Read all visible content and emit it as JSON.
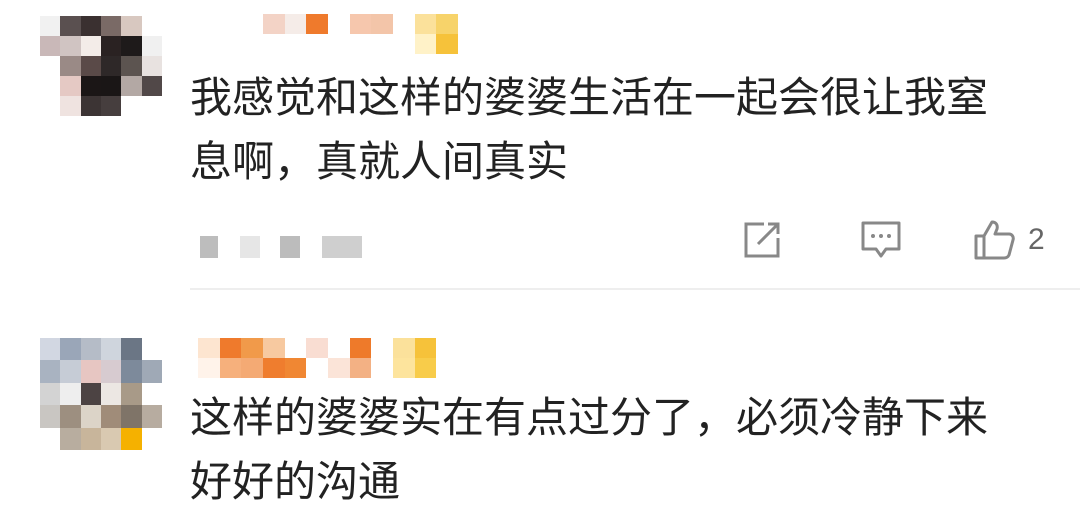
{
  "comments": [
    {
      "text": "我感觉和这样的婆婆生活在一起会很让我窒\n息啊，真就人间真实",
      "likes": "2",
      "icons": [
        "share-icon",
        "reply-icon",
        "thumbs-up-icon"
      ]
    },
    {
      "text": "这样的婆婆实在有点过分了，必须冷静下来\n好好的沟通"
    }
  ],
  "colors": {
    "text": "#222222",
    "icon": "#888888",
    "divider": "#eeeeee",
    "name_orange": "#ee7a2a",
    "name_yellow": "#f6c342"
  }
}
